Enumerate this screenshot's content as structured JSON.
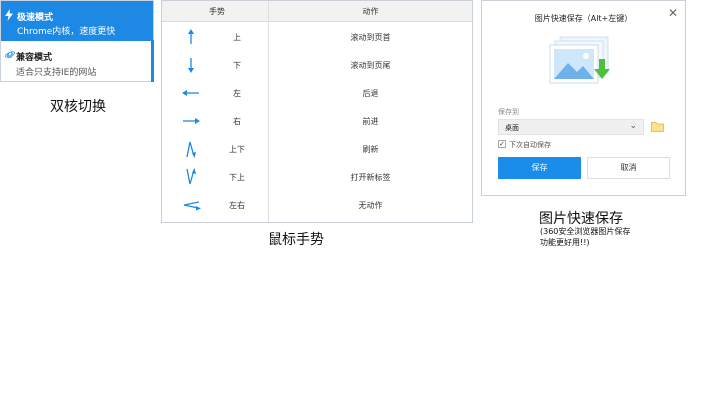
{
  "core": {
    "fast": {
      "title": "极速模式",
      "desc": "Chrome内核，速度更快"
    },
    "compat": {
      "title": "兼容模式",
      "desc": "适合只支持IE的网站"
    },
    "caption": "双核切换",
    "icons": {
      "fast": "lightning-icon",
      "compat": "ie-icon"
    },
    "accent": "#1e88e5"
  },
  "gestures": {
    "headers": {
      "gesture": "手势",
      "action": "动作"
    },
    "rows": [
      {
        "icon": "arrow-up-icon",
        "name": "上",
        "action": "滚动到页首"
      },
      {
        "icon": "arrow-down-icon",
        "name": "下",
        "action": "滚动到页尾"
      },
      {
        "icon": "arrow-left-icon",
        "name": "左",
        "action": "后退"
      },
      {
        "icon": "arrow-right-icon",
        "name": "右",
        "action": "前进"
      },
      {
        "icon": "gesture-up-down-icon",
        "name": "上下",
        "action": "刷新"
      },
      {
        "icon": "gesture-down-up-icon",
        "name": "下上",
        "action": "打开新标签"
      },
      {
        "icon": "gesture-left-right-icon",
        "name": "左右",
        "action": "无动作"
      }
    ],
    "caption": "鼠标手势"
  },
  "save": {
    "title": "图片快速保存（Alt+左键）",
    "save_to_label": "保存到",
    "location": "桌面",
    "auto_save_label": "下次自动保存",
    "auto_save_checked": true,
    "save_button": "保存",
    "cancel_button": "取消",
    "caption": "图片快速保存",
    "note_line1": "(360安全浏览器图片保存",
    "note_line2": "功能更好用!!)",
    "accent": "#1a8dea"
  }
}
